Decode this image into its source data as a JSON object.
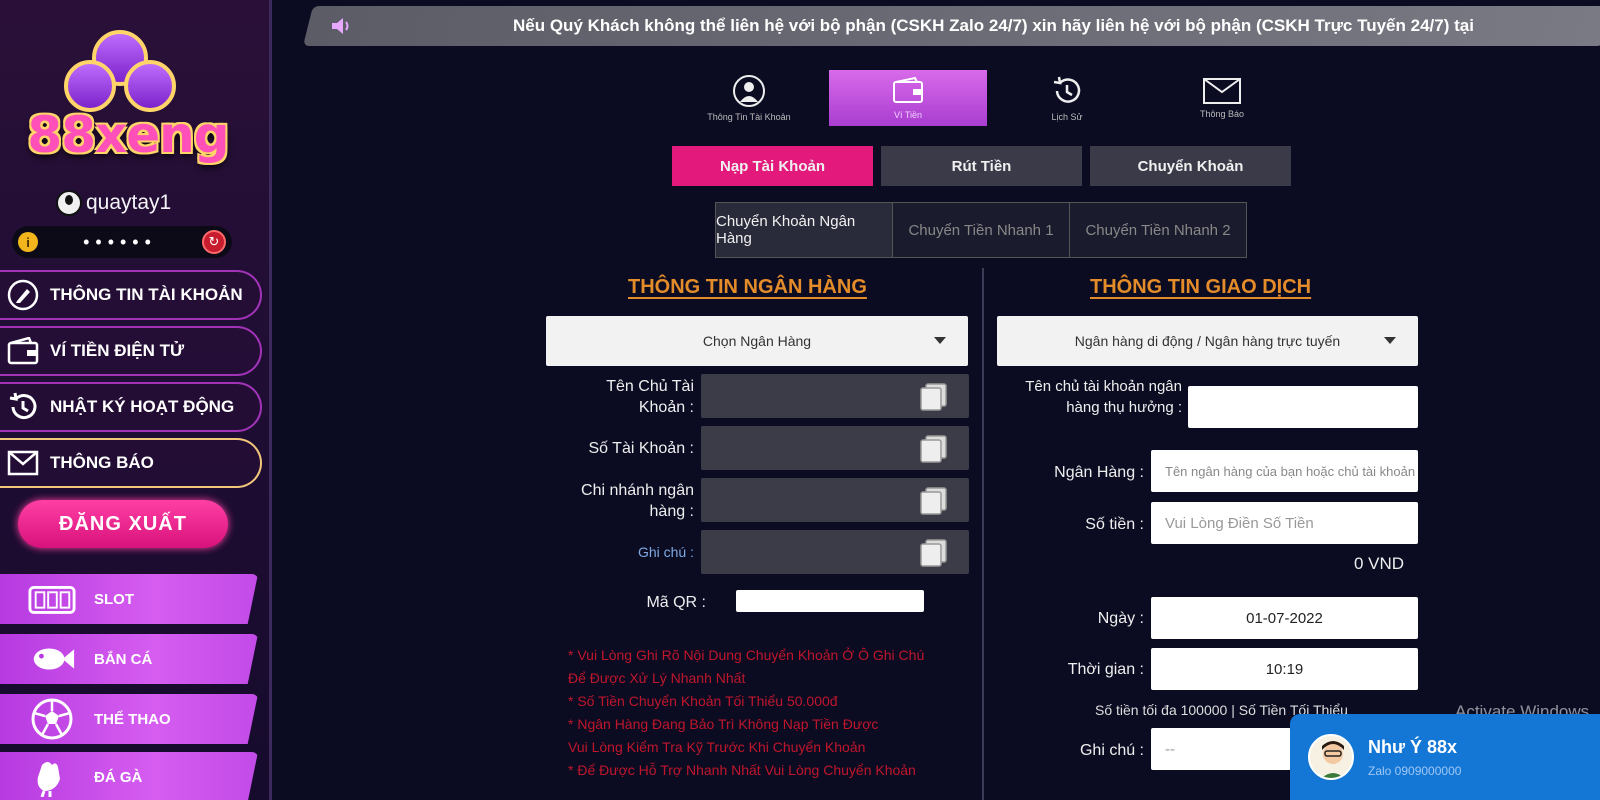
{
  "brand": {
    "logo_text": "88xeng"
  },
  "user": {
    "username": "quaytay1",
    "balance_mask": "••••••"
  },
  "sidebar": {
    "menu": [
      {
        "label": "THÔNG TIN TÀI KHOẢN",
        "icon": "edit-icon"
      },
      {
        "label": "VÍ TIỀN ĐIỆN TỬ",
        "icon": "wallet-icon"
      },
      {
        "label": "NHẬT KÝ HOẠT ĐỘNG",
        "icon": "history-icon"
      },
      {
        "label": "THÔNG BÁO",
        "icon": "mail-icon"
      }
    ],
    "logout_label": "ĐĂNG XUẤT",
    "games": [
      {
        "label": "SLOT",
        "icon": "slot-machine-icon"
      },
      {
        "label": "BẮN CÁ",
        "icon": "fish-icon"
      },
      {
        "label": "THỂ THAO",
        "icon": "soccer-ball-icon"
      },
      {
        "label": "ĐÁ GÀ",
        "icon": "rooster-icon"
      }
    ]
  },
  "marquee": {
    "text": "Nếu Quý Khách không thể liên hệ với bộ phận (CSKH Zalo 24/7) xin hãy liên hệ với bộ phận (CSKH Trực Tuyến 24/7) tại"
  },
  "top_tabs": [
    {
      "label": "Thông Tin Tài Khoản",
      "icon": "profile-icon"
    },
    {
      "label": "Ví Tiền",
      "icon": "wallet-icon"
    },
    {
      "label": "Lịch Sử",
      "icon": "history-icon"
    },
    {
      "label": "Thông Báo",
      "icon": "mail-icon"
    }
  ],
  "sub_tabs": [
    "Nạp Tài Khoản",
    "Rút Tiền",
    "Chuyển Khoản"
  ],
  "method_tabs": [
    "Chuyển Khoản Ngân Hàng",
    "Chuyển Tiền Nhanh 1",
    "Chuyển Tiền Nhanh 2"
  ],
  "bank_info": {
    "title": "THÔNG TIN NGÂN HÀNG",
    "select_placeholder": "Chọn Ngân Hàng",
    "fields": [
      {
        "label": "Tên Chủ Tài Khoản :"
      },
      {
        "label": "Số Tài Khoản :"
      },
      {
        "label": "Chi nhánh ngân hàng :"
      },
      {
        "label": "Ghi chú :"
      }
    ],
    "qr_label": "Mã QR :",
    "notes": [
      "* Vui Lòng Ghi Rõ Nội Dung Chuyển Khoản Ở Ô Ghi Chú",
      "Để Được Xử Lý Nhanh Nhất",
      "* Số Tiền Chuyển Khoản Tối Thiểu 50.000đ",
      "* Ngân Hàng Đang Bảo Trì Không Nạp Tiền Được",
      "Vui Lòng Kiểm Tra Kỹ Trước Khi Chuyển Khoản",
      "* Để Được Hỗ Trợ Nhanh Nhất Vui Lòng Chuyển Khoản"
    ]
  },
  "transaction_info": {
    "title": "THÔNG TIN GIAO DỊCH",
    "method_select": "Ngân hàng di động / Ngân hàng trực tuyến",
    "receiver_label": "Tên chủ tài khoản ngân hàng thụ hưởng :",
    "receiver_value": "",
    "bank_label": "Ngân Hàng :",
    "bank_value": "Tên ngân hàng của bạn hoặc chủ tài khoản",
    "amount_label": "Số tiền :",
    "amount_placeholder": "Vui Lòng Điền Số Tiền",
    "amount_display": "0 VND",
    "date_label": "Ngày :",
    "date_value": "01-07-2022",
    "time_label": "Thời gian :",
    "time_value": "10:19",
    "range_note": "Số tiền tối đa 100000 | Số Tiền Tối Thiểu",
    "note_label": "Ghi chú :",
    "note_value": "--"
  },
  "chat": {
    "name": "Như Ý 88x",
    "subtitle": "Zalo 0909000000"
  },
  "watermark": "Activate Windows",
  "colors": {
    "accent_pink": "#e3197c",
    "accent_purple": "#b63ae0",
    "title_orange": "#e48b2a",
    "note_red": "#c0162c"
  }
}
